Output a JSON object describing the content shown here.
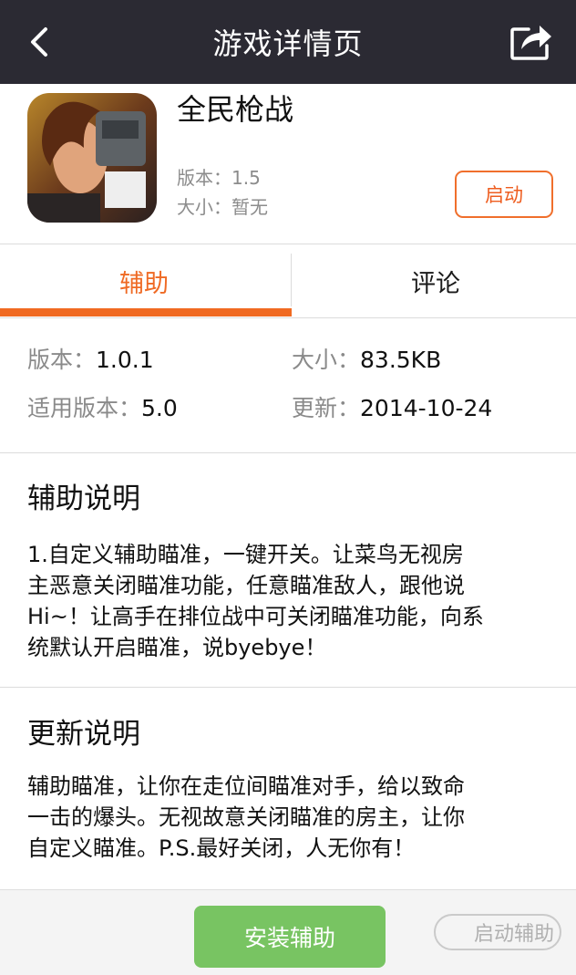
{
  "nav": {
    "title": "游戏详情页"
  },
  "app": {
    "name": "全民枪战",
    "version": "版本：1.5",
    "size": "大小：暂无",
    "launch_label": "启动"
  },
  "tabs": [
    {
      "label": "辅助",
      "active": true
    },
    {
      "label": "评论",
      "active": false
    }
  ],
  "info": {
    "version_label": "版本：",
    "version_value": "1.0.1",
    "size_label": "大小：",
    "size_value": "83.5KB",
    "compat_label": "适用版本：",
    "compat_value": "5.0",
    "update_label": "更新：",
    "update_value": "2014-10-24"
  },
  "assist": {
    "title": "辅助说明",
    "lines": [
      "1.自定义辅助瞄准，一键开关。让菜鸟无视房",
      "主恶意关闭瞄准功能，任意瞄准敌人，跟他说",
      "Hi~！让高手在排位战中可关闭瞄准功能，向系",
      "统默认开启瞄准，说byebye！"
    ]
  },
  "update": {
    "title": "更新说明",
    "lines": [
      "辅助瞄准，让你在走位间瞄准对手，给以致命",
      "一击的爆头。无视故意关闭瞄准的房主，让你",
      "自定义瞄准。P.S.最好关闭，人无你有！"
    ]
  },
  "bottom": {
    "install_label": "安装辅助",
    "watermark": "启动辅助"
  },
  "colors": {
    "accent": "#ef6a24",
    "navbar": "#2b2a33",
    "install": "#78c462"
  },
  "icons": {
    "back": "back-arrow-icon",
    "share": "share-icon"
  }
}
